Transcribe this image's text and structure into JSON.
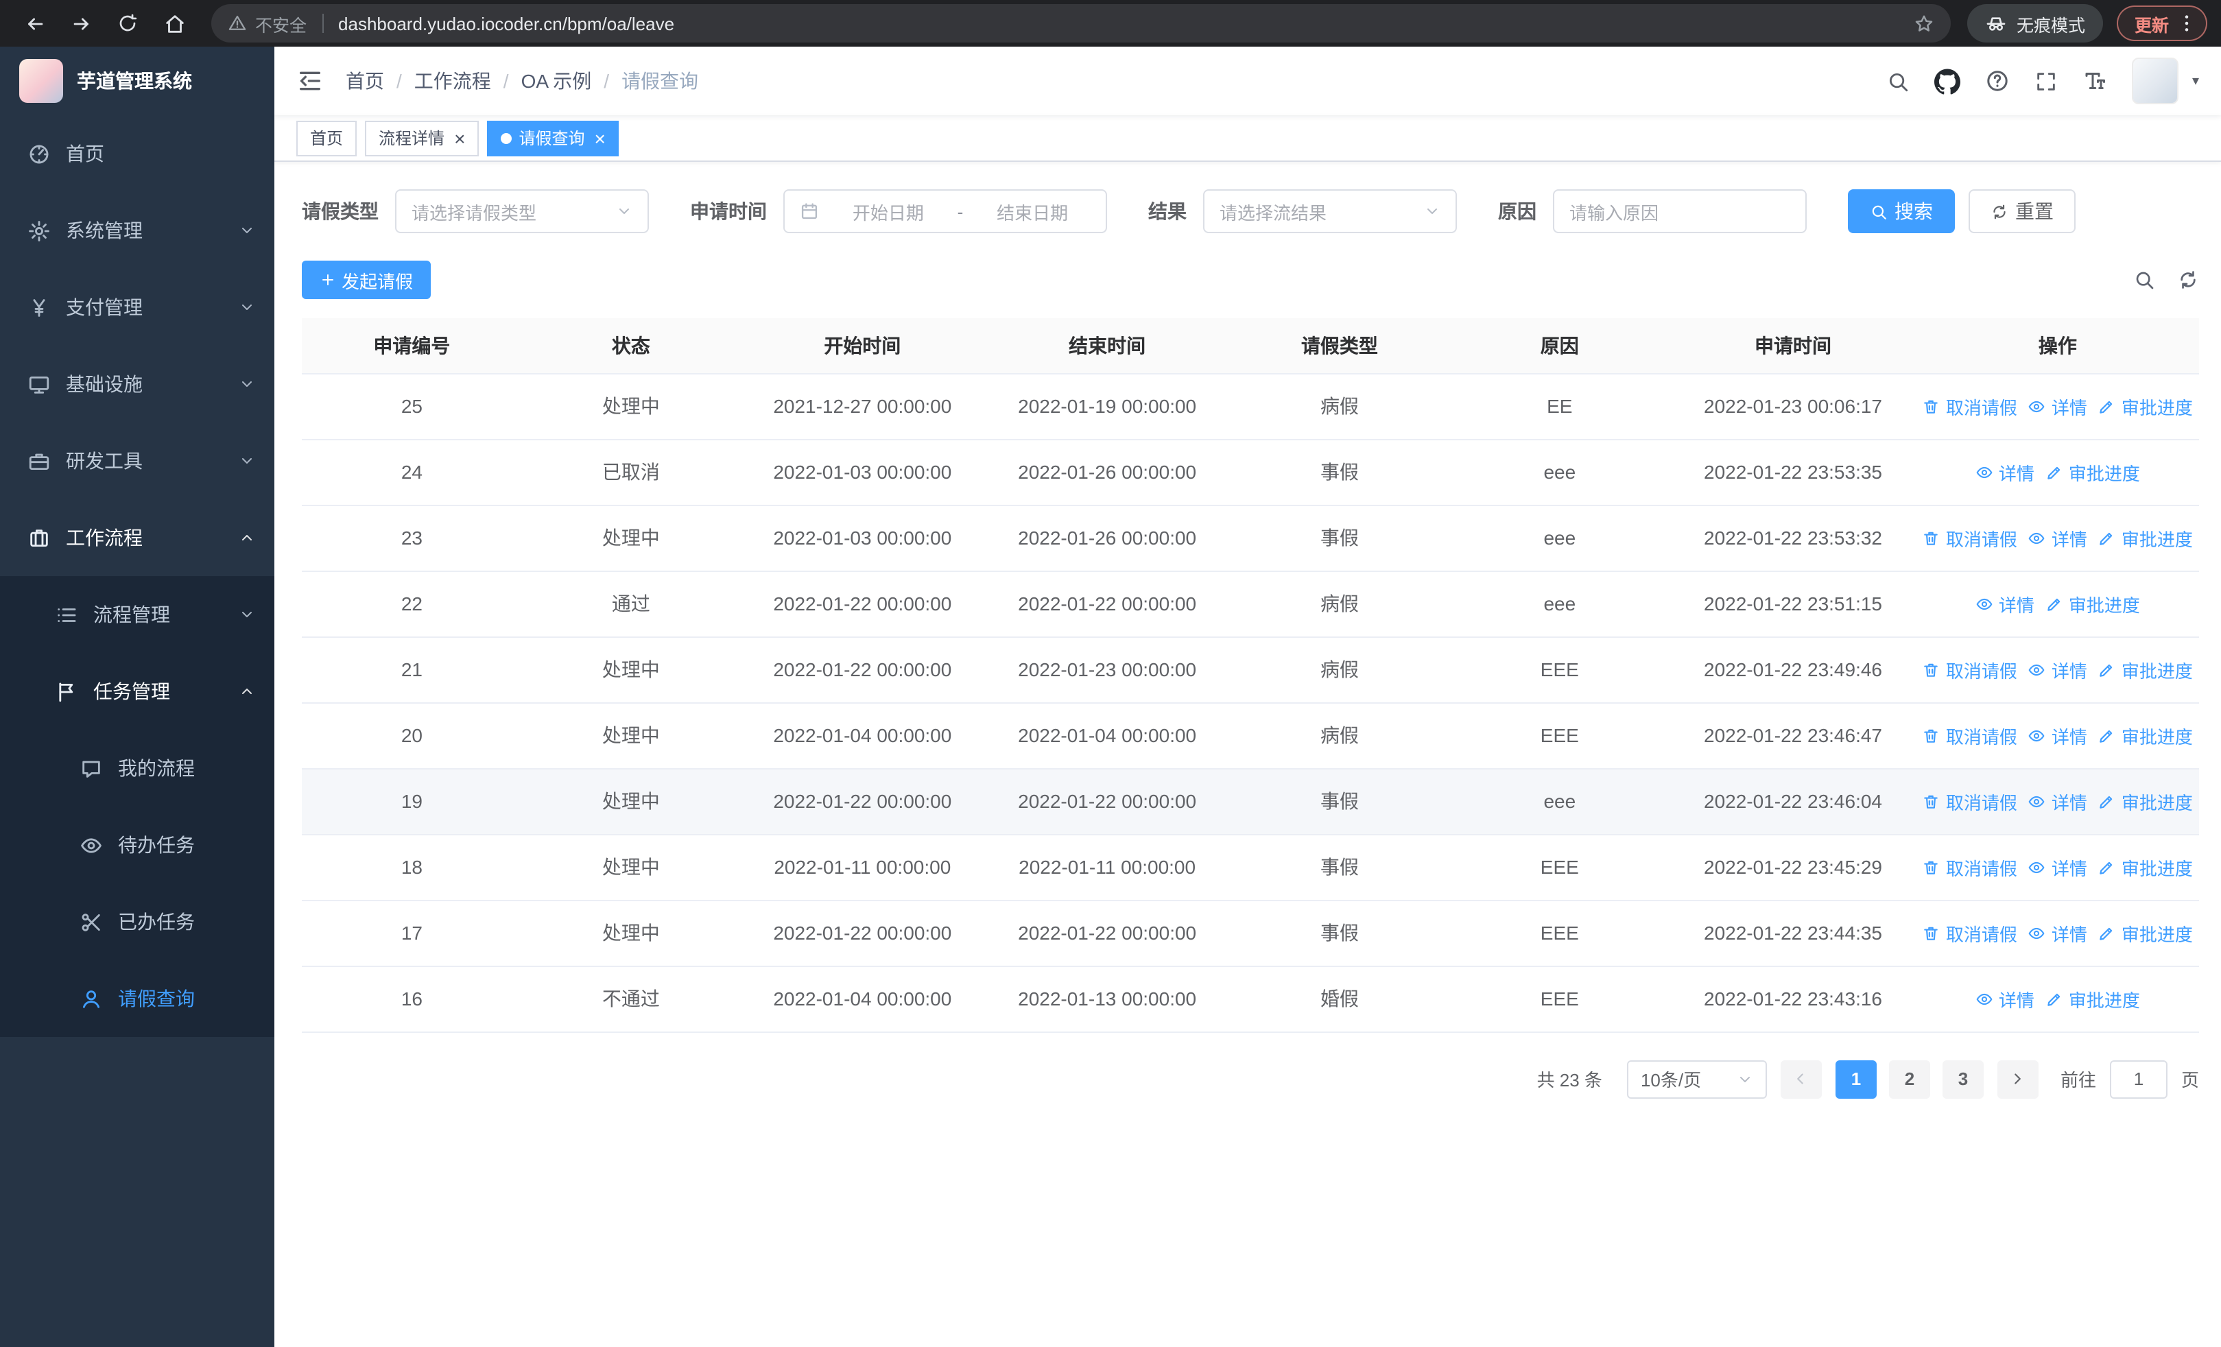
{
  "browser": {
    "security_label": "不安全",
    "url": "dashboard.yudao.iocoder.cn/bpm/oa/leave",
    "incognito_label": "无痕模式",
    "update_label": "更新"
  },
  "sidebar": {
    "logo_title": "芋道管理系统",
    "items": [
      {
        "id": "home",
        "label": "首页",
        "icon": "dashboard-icon",
        "level": 1
      },
      {
        "id": "system-management",
        "label": "系统管理",
        "icon": "gear-icon",
        "level": 1,
        "chevron": "down"
      },
      {
        "id": "payment-management",
        "label": "支付管理",
        "icon": "yen-icon",
        "level": 1,
        "chevron": "down"
      },
      {
        "id": "infrastructure",
        "label": "基础设施",
        "icon": "monitor-icon",
        "level": 1,
        "chevron": "down"
      },
      {
        "id": "dev-tools",
        "label": "研发工具",
        "icon": "briefcase-icon",
        "level": 1,
        "chevron": "down"
      },
      {
        "id": "workflow",
        "label": "工作流程",
        "icon": "suitcase-icon",
        "level": 1,
        "chevron": "up",
        "open": true
      },
      {
        "id": "process-management",
        "label": "流程管理",
        "icon": "list-icon",
        "level": 2,
        "chevron": "down"
      },
      {
        "id": "task-management",
        "label": "任务管理",
        "icon": "flag-icon",
        "level": 2,
        "chevron": "up",
        "open": true
      },
      {
        "id": "my-process",
        "label": "我的流程",
        "icon": "chat-icon",
        "level": 3
      },
      {
        "id": "todo-tasks",
        "label": "待办任务",
        "icon": "eye-icon",
        "level": 3
      },
      {
        "id": "done-tasks",
        "label": "已办任务",
        "icon": "scissors-icon",
        "level": 3
      },
      {
        "id": "leave-query",
        "label": "请假查询",
        "icon": "user-icon",
        "level": 3,
        "active": true
      }
    ]
  },
  "header": {
    "breadcrumb": [
      "首页",
      "工作流程",
      "OA 示例",
      "请假查询"
    ]
  },
  "tabs": [
    {
      "id": "home",
      "label": "首页",
      "closable": false,
      "active": false
    },
    {
      "id": "process-detail",
      "label": "流程详情",
      "closable": true,
      "active": false
    },
    {
      "id": "leave-query",
      "label": "请假查询",
      "closable": true,
      "active": true
    }
  ],
  "filters": {
    "leave_type_label": "请假类型",
    "leave_type_placeholder": "请选择请假类型",
    "apply_time_label": "申请时间",
    "start_date_placeholder": "开始日期",
    "range_separator": "-",
    "end_date_placeholder": "结束日期",
    "result_label": "结果",
    "result_placeholder": "请选择流结果",
    "reason_label": "原因",
    "reason_placeholder": "请输入原因",
    "search_button": "搜索",
    "reset_button": "重置"
  },
  "toolbar": {
    "create_button": "发起请假"
  },
  "table": {
    "columns": [
      "申请编号",
      "状态",
      "开始时间",
      "结束时间",
      "请假类型",
      "原因",
      "申请时间",
      "操作"
    ],
    "action_labels": {
      "cancel": "取消请假",
      "detail": "详情",
      "progress": "审批进度"
    },
    "rows": [
      {
        "id": "25",
        "status": "处理中",
        "start": "2021-12-27 00:00:00",
        "end": "2022-01-19 00:00:00",
        "type": "病假",
        "reason": "EE",
        "applied": "2022-01-23 00:06:17",
        "actions": [
          "cancel",
          "detail",
          "progress"
        ]
      },
      {
        "id": "24",
        "status": "已取消",
        "start": "2022-01-03 00:00:00",
        "end": "2022-01-26 00:00:00",
        "type": "事假",
        "reason": "eee",
        "applied": "2022-01-22 23:53:35",
        "actions": [
          "detail",
          "progress"
        ]
      },
      {
        "id": "23",
        "status": "处理中",
        "start": "2022-01-03 00:00:00",
        "end": "2022-01-26 00:00:00",
        "type": "事假",
        "reason": "eee",
        "applied": "2022-01-22 23:53:32",
        "actions": [
          "cancel",
          "detail",
          "progress"
        ]
      },
      {
        "id": "22",
        "status": "通过",
        "start": "2022-01-22 00:00:00",
        "end": "2022-01-22 00:00:00",
        "type": "病假",
        "reason": "eee",
        "applied": "2022-01-22 23:51:15",
        "actions": [
          "detail",
          "progress"
        ]
      },
      {
        "id": "21",
        "status": "处理中",
        "start": "2022-01-22 00:00:00",
        "end": "2022-01-23 00:00:00",
        "type": "病假",
        "reason": "EEE",
        "applied": "2022-01-22 23:49:46",
        "actions": [
          "cancel",
          "detail",
          "progress"
        ]
      },
      {
        "id": "20",
        "status": "处理中",
        "start": "2022-01-04 00:00:00",
        "end": "2022-01-04 00:00:00",
        "type": "病假",
        "reason": "EEE",
        "applied": "2022-01-22 23:46:47",
        "actions": [
          "cancel",
          "detail",
          "progress"
        ]
      },
      {
        "id": "19",
        "status": "处理中",
        "start": "2022-01-22 00:00:00",
        "end": "2022-01-22 00:00:00",
        "type": "事假",
        "reason": "eee",
        "applied": "2022-01-22 23:46:04",
        "actions": [
          "cancel",
          "detail",
          "progress"
        ],
        "highlighted": true
      },
      {
        "id": "18",
        "status": "处理中",
        "start": "2022-01-11 00:00:00",
        "end": "2022-01-11 00:00:00",
        "type": "事假",
        "reason": "EEE",
        "applied": "2022-01-22 23:45:29",
        "actions": [
          "cancel",
          "detail",
          "progress"
        ]
      },
      {
        "id": "17",
        "status": "处理中",
        "start": "2022-01-22 00:00:00",
        "end": "2022-01-22 00:00:00",
        "type": "事假",
        "reason": "EEE",
        "applied": "2022-01-22 23:44:35",
        "actions": [
          "cancel",
          "detail",
          "progress"
        ]
      },
      {
        "id": "16",
        "status": "不通过",
        "start": "2022-01-04 00:00:00",
        "end": "2022-01-13 00:00:00",
        "type": "婚假",
        "reason": "EEE",
        "applied": "2022-01-22 23:43:16",
        "actions": [
          "detail",
          "progress"
        ]
      }
    ]
  },
  "pagination": {
    "total_text": "共 23 条",
    "page_size": "10条/页",
    "pages": [
      "1",
      "2",
      "3"
    ],
    "active_page": "1",
    "goto_label": "前往",
    "goto_value": "1",
    "goto_suffix": "页"
  }
}
